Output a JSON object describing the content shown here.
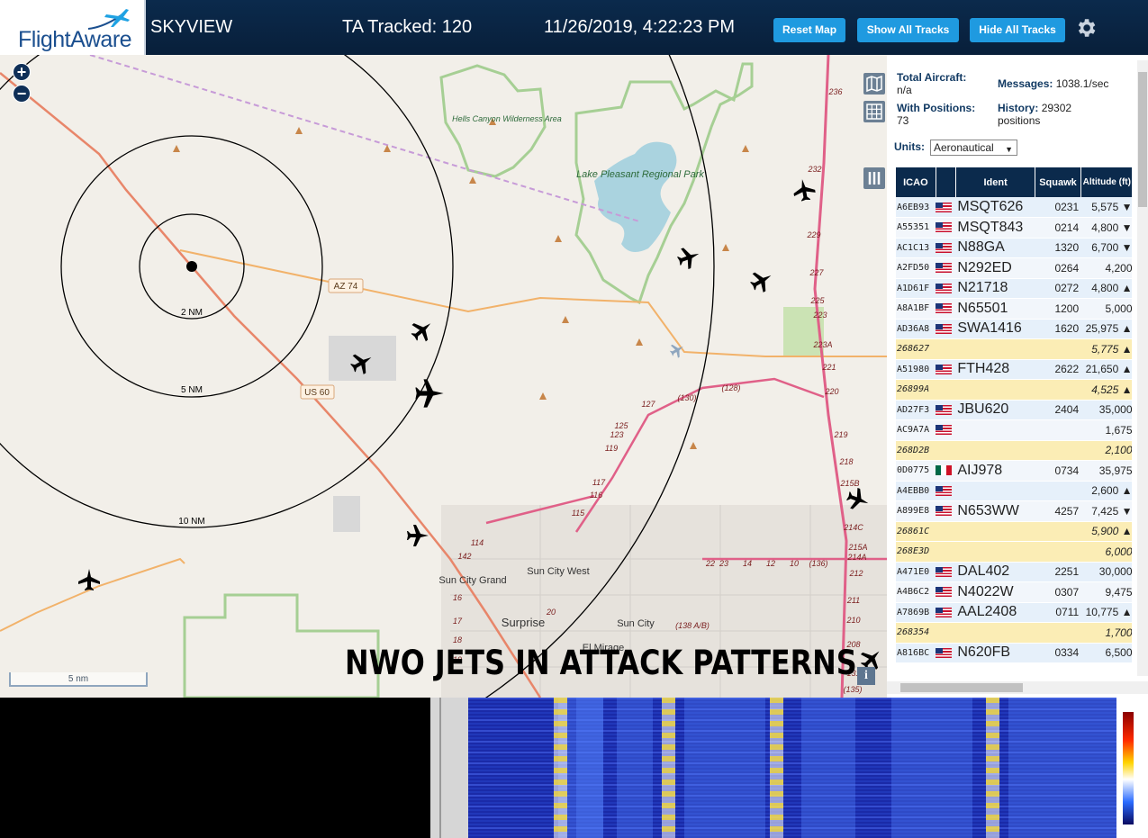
{
  "header": {
    "logo_text": "FlightAware",
    "app_name": "SKYVIEW",
    "tracked": "TA Tracked: 120",
    "datetime": "11/26/2019, 4:22:23 PM",
    "buttons": {
      "reset_map": "Reset Map",
      "show_tracks": "Show All Tracks",
      "hide_tracks": "Hide All Tracks"
    },
    "settings_icon": "gear-icon"
  },
  "map": {
    "zoom_in": "+",
    "zoom_out": "−",
    "scale_label": "5 nm",
    "info_label": "i",
    "caption": "NWO JETS IN ATTACK PATTERNS",
    "range_rings": [
      "2 NM",
      "5 NM",
      "10 NM"
    ],
    "road_labels": [
      "AZ 74",
      "US 60"
    ],
    "places": [
      "Hells Canyon Wilderness Area",
      "Lake Pleasant Regional Park",
      "Sun City Grand",
      "Sun City West",
      "Surprise",
      "Sun City",
      "El Mirage"
    ],
    "exit_numbers": [
      "236",
      "232",
      "229",
      "227",
      "225",
      "223",
      "223A",
      "221",
      "220",
      "219",
      "218",
      "215B",
      "214C",
      "215A",
      "214A",
      "212",
      "211",
      "210",
      "208",
      "131",
      "(135)",
      "(130)",
      "(128)",
      "127",
      "125",
      "123",
      "119",
      "117",
      "116",
      "115",
      "114",
      "142",
      "16",
      "17",
      "18",
      "19",
      "20",
      "22",
      "23",
      "14",
      "12",
      "10",
      "(136)",
      "(138 A/B)"
    ],
    "colors": {
      "land": "#f2efe9",
      "park": "#cbe3b4",
      "water": "#aad3df",
      "highway": "#e06088",
      "road": "#f2b26a",
      "ring": "#000000"
    }
  },
  "sidebar": {
    "total_aircraft_label": "Total Aircraft:",
    "total_aircraft_value": "n/a",
    "with_positions_label": "With Positions:",
    "with_positions_value": "73",
    "messages_label": "Messages:",
    "messages_value": "1038.1/sec",
    "history_label": "History:",
    "history_value": "29302 positions",
    "units_label": "Units:",
    "units_value": "Aeronautical",
    "columns": [
      "ICAO",
      "",
      "Ident",
      "Squawk",
      "Altitude (ft)"
    ],
    "rows": [
      {
        "icao": "A6EB93",
        "flag": "us",
        "ident": "MSQT626",
        "squawk": "0231",
        "altitude": "5,575 ▼",
        "pos": true
      },
      {
        "icao": "A55351",
        "flag": "us",
        "ident": "MSQT843",
        "squawk": "0214",
        "altitude": "4,800 ▼",
        "pos": true
      },
      {
        "icao": "AC1C13",
        "flag": "us",
        "ident": "N88GA",
        "squawk": "1320",
        "altitude": "6,700 ▼",
        "pos": true
      },
      {
        "icao": "A2FD50",
        "flag": "us",
        "ident": "N292ED",
        "squawk": "0264",
        "altitude": "4,200",
        "pos": true
      },
      {
        "icao": "A1D61F",
        "flag": "us",
        "ident": "N21718",
        "squawk": "0272",
        "altitude": "4,800 ▲",
        "pos": true
      },
      {
        "icao": "A8A1BF",
        "flag": "us",
        "ident": "N65501",
        "squawk": "1200",
        "altitude": "5,000",
        "pos": true
      },
      {
        "icao": "AD36A8",
        "flag": "us",
        "ident": "SWA1416",
        "squawk": "1620",
        "altitude": "25,975 ▲",
        "pos": true
      },
      {
        "icao": "268627",
        "flag": "",
        "ident": "",
        "squawk": "",
        "altitude": "5,775 ▲",
        "pos": false
      },
      {
        "icao": "A51980",
        "flag": "us",
        "ident": "FTH428",
        "squawk": "2622",
        "altitude": "21,650 ▲",
        "pos": true
      },
      {
        "icao": "26899A",
        "flag": "",
        "ident": "",
        "squawk": "",
        "altitude": "4,525 ▲",
        "pos": false
      },
      {
        "icao": "AD27F3",
        "flag": "us",
        "ident": "JBU620",
        "squawk": "2404",
        "altitude": "35,000",
        "pos": true
      },
      {
        "icao": "AC9A7A",
        "flag": "us",
        "ident": "",
        "squawk": "",
        "altitude": "1,675",
        "pos": true
      },
      {
        "icao": "268D2B",
        "flag": "",
        "ident": "",
        "squawk": "",
        "altitude": "2,100",
        "pos": false
      },
      {
        "icao": "0D0775",
        "flag": "mx",
        "ident": "AIJ978",
        "squawk": "0734",
        "altitude": "35,975",
        "pos": true
      },
      {
        "icao": "A4EBB0",
        "flag": "us",
        "ident": "",
        "squawk": "",
        "altitude": "2,600 ▲",
        "pos": true
      },
      {
        "icao": "A899E8",
        "flag": "us",
        "ident": "N653WW",
        "squawk": "4257",
        "altitude": "7,425 ▼",
        "pos": true
      },
      {
        "icao": "26861C",
        "flag": "",
        "ident": "",
        "squawk": "",
        "altitude": "5,900 ▲",
        "pos": false
      },
      {
        "icao": "268E3D",
        "flag": "",
        "ident": "",
        "squawk": "",
        "altitude": "6,000",
        "pos": false
      },
      {
        "icao": "A471E0",
        "flag": "us",
        "ident": "DAL402",
        "squawk": "2251",
        "altitude": "30,000",
        "pos": true
      },
      {
        "icao": "A4B6C2",
        "flag": "us",
        "ident": "N4022W",
        "squawk": "0307",
        "altitude": "9,475",
        "pos": true
      },
      {
        "icao": "A7869B",
        "flag": "us",
        "ident": "AAL2408",
        "squawk": "0711",
        "altitude": "10,775 ▲",
        "pos": true
      },
      {
        "icao": "268354",
        "flag": "",
        "ident": "",
        "squawk": "",
        "altitude": "1,700",
        "pos": false
      },
      {
        "icao": "A816BC",
        "flag": "us",
        "ident": "N620FB",
        "squawk": "0334",
        "altitude": "6,500",
        "pos": true
      }
    ]
  }
}
